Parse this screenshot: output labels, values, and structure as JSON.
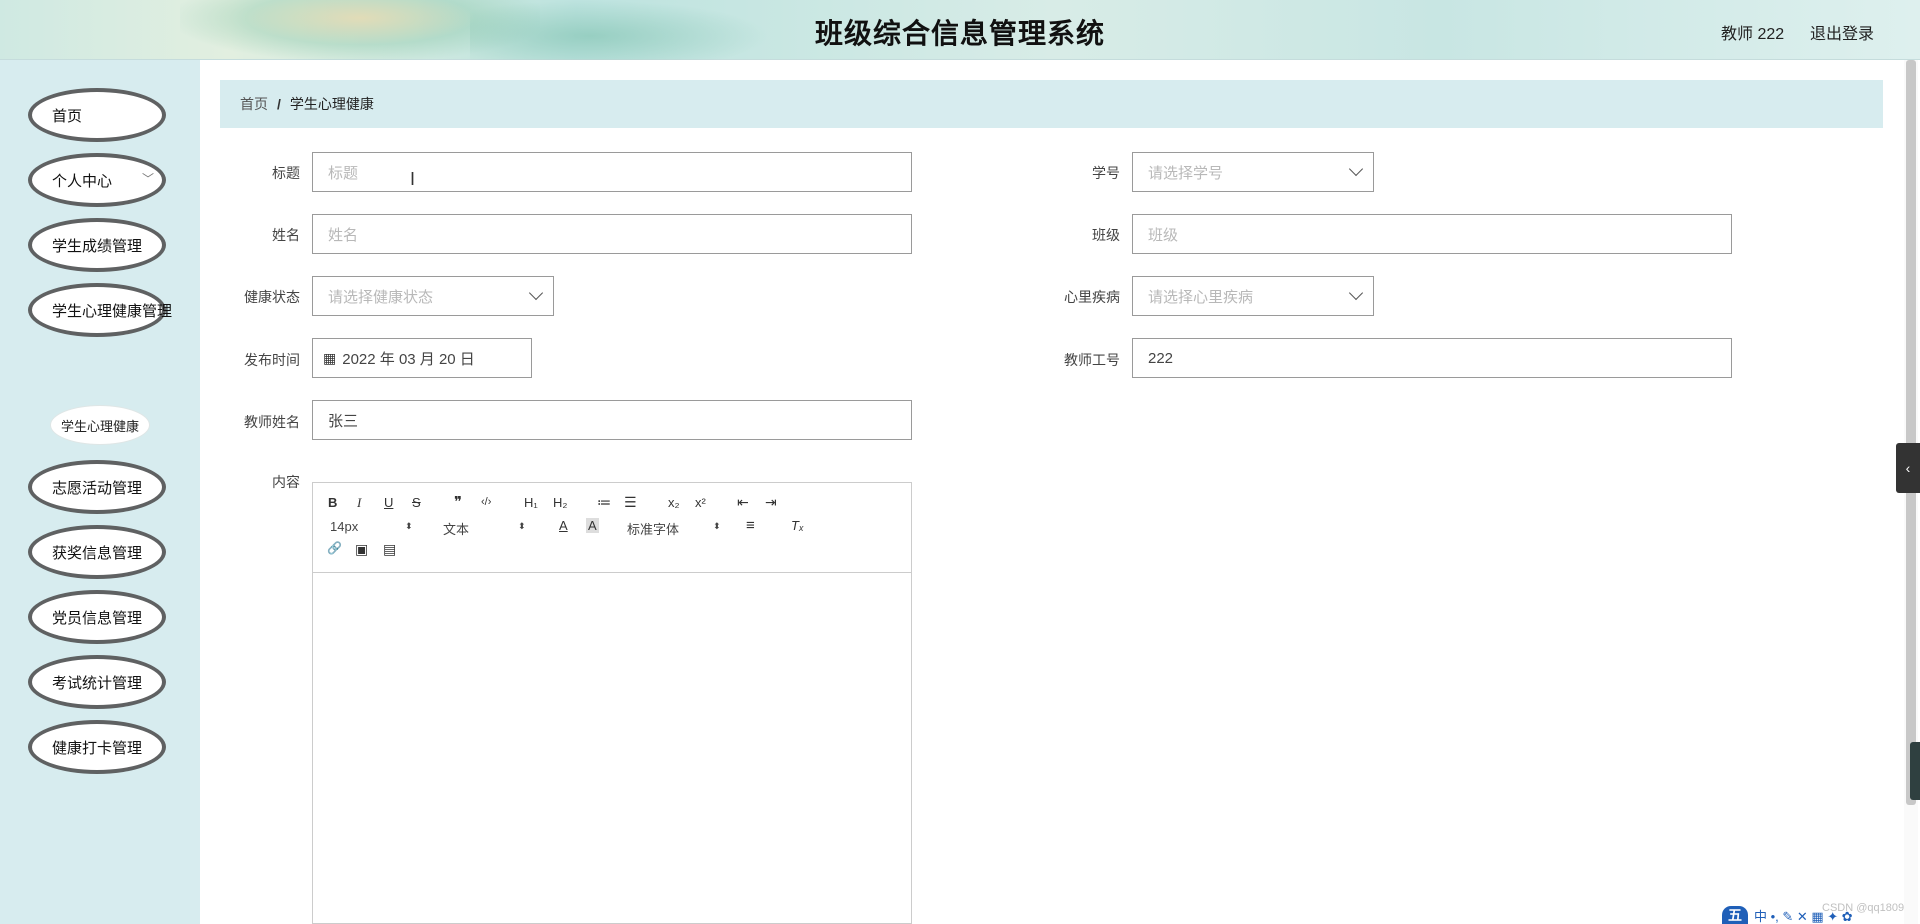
{
  "header": {
    "title": "班级综合信息管理系统",
    "user": "教师 222",
    "logout": "退出登录"
  },
  "sidebar": {
    "items": [
      {
        "label": "首页"
      },
      {
        "label": "个人中心"
      },
      {
        "label": "学生成绩管理"
      },
      {
        "label": "学生心理健康管理"
      },
      {
        "label": "志愿活动管理"
      },
      {
        "label": "获奖信息管理"
      },
      {
        "label": "党员信息管理"
      },
      {
        "label": "考试统计管理"
      },
      {
        "label": "健康打卡管理"
      }
    ],
    "sub_item": "学生心理健康"
  },
  "breadcrumb": {
    "home": "首页",
    "separator": "/",
    "current": "学生心理健康"
  },
  "form": {
    "title_label": "标题",
    "title_placeholder": "标题",
    "student_id_label": "学号",
    "student_id_placeholder": "请选择学号",
    "name_label": "姓名",
    "name_placeholder": "姓名",
    "class_label": "班级",
    "class_placeholder": "班级",
    "health_label": "健康状态",
    "health_placeholder": "请选择健康状态",
    "disease_label": "心里疾病",
    "disease_placeholder": "请选择心里疾病",
    "publish_label": "发布时间",
    "publish_value": "2022 年 03 月 20 日",
    "teacher_id_label": "教师工号",
    "teacher_id_value": "222",
    "teacher_name_label": "教师姓名",
    "teacher_name_value": "张三",
    "content_label": "内容"
  },
  "editor": {
    "font_size": "14px",
    "header_select": "文本",
    "font_family": "标准字体",
    "buttons": {
      "bold": "B",
      "italic": "I",
      "underline": "U",
      "strike": "S",
      "blockquote": "❞",
      "code": "‹/›",
      "h1": "H₁",
      "h2": "H₂",
      "ordered_list": "≔",
      "bullet_list": "☰",
      "sub": "x₂",
      "sup": "x²",
      "outdent": "⇤",
      "indent": "⇥",
      "color": "A",
      "background": "A",
      "align": "≡",
      "clean": "Tₓ",
      "link": "🔗",
      "image": "▣",
      "video": "▤"
    }
  },
  "footer": {
    "watermark": "CSDN @qq1809",
    "ime_logo": "五",
    "ime_text": "中 •, ✎ ✕ ▦ ✦ ✿"
  },
  "side_handle": "‹"
}
